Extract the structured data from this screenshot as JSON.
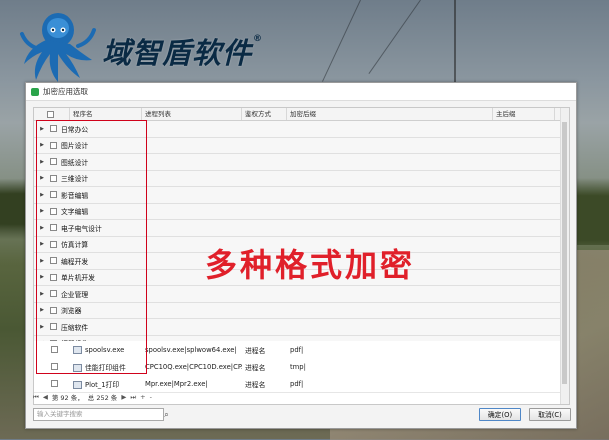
{
  "logo": {
    "text": "域智盾软件",
    "reg": "®"
  },
  "dialog": {
    "title": "加密应用选取",
    "columns": [
      "程序名",
      "进程列表",
      "鉴权方式",
      "加密后缀",
      "主后缀"
    ],
    "groups": [
      {
        "label": "日常办公"
      },
      {
        "label": "图片设计"
      },
      {
        "label": "图纸设计"
      },
      {
        "label": "三维设计"
      },
      {
        "label": "影音编辑"
      },
      {
        "label": "文字编辑"
      },
      {
        "label": "电子电气设计"
      },
      {
        "label": "仿真计算"
      },
      {
        "label": "编程开发"
      },
      {
        "label": "单片机开发"
      },
      {
        "label": "企业管理"
      },
      {
        "label": "浏览器"
      },
      {
        "label": "压缩软件"
      },
      {
        "label": "打印组件"
      }
    ],
    "rows": [
      {
        "name": "spoolsv.exe",
        "process": "spoolsv.exe|splwow64.exe|",
        "auth": "进程名",
        "ext": "pdf|",
        "main": ""
      },
      {
        "name": "佳能打印组件",
        "process": "CPC10Q.exe|CPC10D.exe|CP...",
        "auth": "进程名",
        "ext": "tmp|",
        "main": ""
      },
      {
        "name": "Plot_1打印",
        "process": "Mpr.exe|Mpr2.exe|",
        "auth": "进程名",
        "ext": "pdf|",
        "main": ""
      }
    ],
    "pager": {
      "first": "⏮",
      "prev": "◀",
      "page": "第 92 条，",
      "total": "总 252 条",
      "next": "▶",
      "last": "⏭",
      "add": "+",
      "remove": "-"
    },
    "search_placeholder": "输入关键字搜索",
    "ok": "确定(O)",
    "cancel": "取消(C)"
  },
  "overlay": "多种格式加密"
}
